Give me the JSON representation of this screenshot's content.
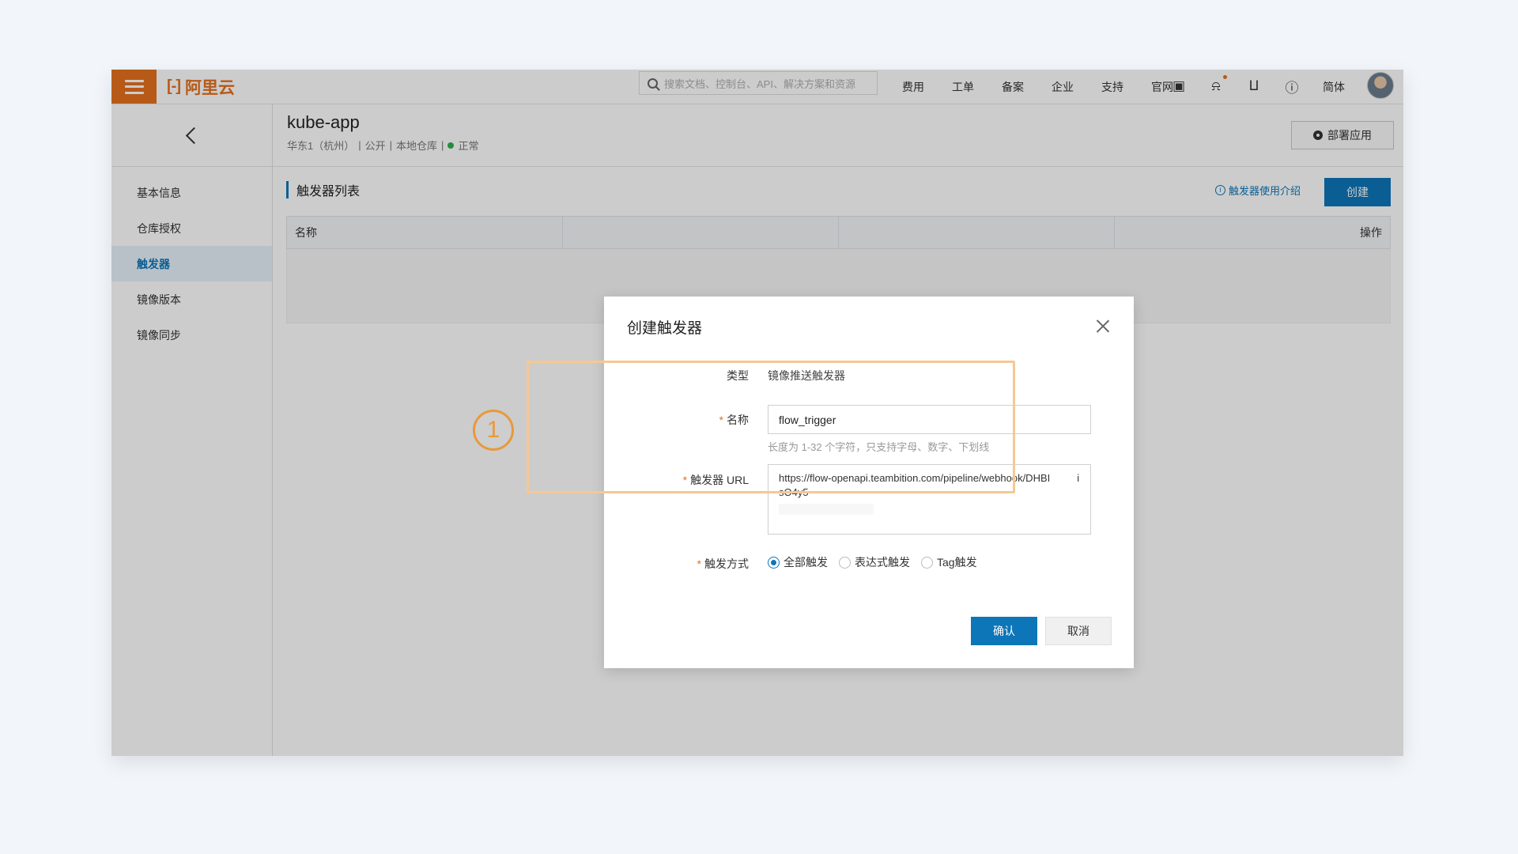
{
  "topbar": {
    "logo_text": "阿里云",
    "search_placeholder": "搜索文档、控制台、API、解决方案和资源",
    "nav_items": [
      "费用",
      "工单",
      "备案",
      "企业",
      "支持",
      "官网"
    ],
    "lang_label": "简体",
    "accent_color": "#e5711f"
  },
  "sidebar": {
    "items": [
      {
        "label": "基本信息"
      },
      {
        "label": "仓库授权"
      },
      {
        "label": "触发器"
      },
      {
        "label": "镜像版本"
      },
      {
        "label": "镜像同步"
      }
    ],
    "active_index": 2
  },
  "header": {
    "title": "kube-app",
    "meta_region": "华东1（杭州）",
    "meta_public": "公开",
    "meta_repo": "本地仓库",
    "meta_status": "正常",
    "deploy_label": "部署应用"
  },
  "main": {
    "section_title": "触发器列表",
    "intro_link": "触发器使用介绍",
    "create_label": "创建",
    "table_headers": [
      "名称",
      "",
      "",
      "操作"
    ]
  },
  "modal": {
    "title": "创建触发器",
    "type_label": "类型",
    "type_value": "镜像推送触发器",
    "name_label": "名称",
    "name_value": "flow_trigger",
    "name_hint": "长度为 1-32 个字符，只支持字母、数字、下划线",
    "url_label": "触发器 URL",
    "url_value_part1": "https://flow-openapi.teambition.com/pipeline/webhook/DHBI",
    "url_value_part2": "isO4y5",
    "mode_label": "触发方式",
    "mode_options": [
      "全部触发",
      "表达式触发",
      "Tag触发"
    ],
    "mode_selected": "全部触发",
    "confirm_label": "确认",
    "cancel_label": "取消"
  },
  "annotation": {
    "callout_number": "1",
    "callout_color": "#e8993a"
  },
  "colors": {
    "primary": "#0d76b8",
    "brand": "#e5711f",
    "status_ok": "#2bb24c"
  }
}
